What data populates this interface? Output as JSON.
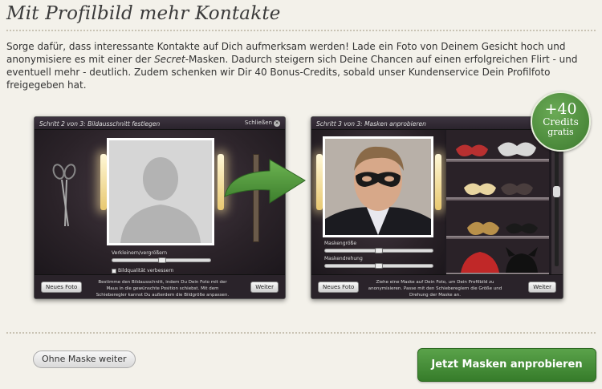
{
  "header": {
    "title": "Mit Profilbild mehr Kontakte"
  },
  "intro": {
    "part1": "Sorge dafür, dass interessante Kontakte auf Dich aufmerksam werden! Lade ein Foto von Deinem Gesicht hoch und anonymisiere es mit einer der ",
    "emphasis": "Secret",
    "part2": "-Masken. Dadurch steigern sich Deine Chancen auf einen erfolgreichen Flirt - und eventuell mehr - deutlich. Zudem schenken wir Dir 40 Bonus-Credits, sobald unser Kundenservice Dein Profilfoto freigegeben hat."
  },
  "step2": {
    "title": "Schritt 2 von 3: Bildausschnitt festlegen",
    "close": "Schließen",
    "zoom_label": "Verkleinern/vergrößern",
    "zoom_value": 0.5,
    "quality_label": "Bildqualität verbessern",
    "new_photo": "Neues Foto",
    "next": "Weiter",
    "help": "Bestimme den Bildausschnitt, indem Du Dein Foto mit der Maus in die gewünschte Position schiebst. Mit dem Schieberegler kannst Du außerdem die Bildgröße anpassen."
  },
  "step3": {
    "title": "Schritt 3 von 3: Masken anprobieren",
    "mask_size_label": "Maskengröße",
    "mask_rotation_label": "Maskendrehung",
    "new_photo": "Neues Foto",
    "next": "Weiter",
    "help": "Ziehe eine Maske auf Dein Foto, um Dein Profilbild zu anonymisieren. Passe mit den Schiebereglern die Größe und Drehung der Maske an."
  },
  "badge": {
    "amount": "+40",
    "unit": "Credits",
    "note": "gratis"
  },
  "actions": {
    "skip_label": "Ohne Maske weiter",
    "primary_label": "Jetzt Masken anprobieren"
  },
  "colors": {
    "accent": "#4a8f3c",
    "window": "#1f1a20"
  }
}
